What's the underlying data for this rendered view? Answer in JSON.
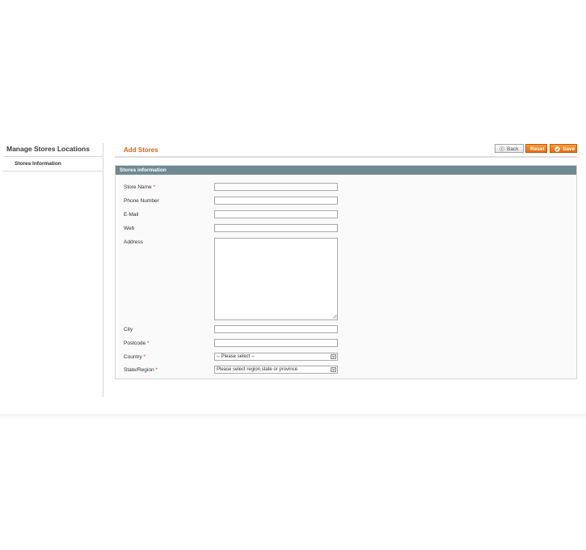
{
  "sidebar": {
    "title": "Manage Stores Locations",
    "tabs": [
      {
        "label": "Stores Information"
      }
    ]
  },
  "header": {
    "title": "Add Stores",
    "buttons": {
      "back": "Back",
      "reset": "Reset",
      "save": "Save"
    }
  },
  "fieldset": {
    "legend": "Stores information",
    "fields": {
      "store_name": {
        "label": "Store Name",
        "required": "*",
        "value": ""
      },
      "phone": {
        "label": "Phone Number",
        "value": ""
      },
      "email": {
        "label": "E-Mail",
        "value": ""
      },
      "web": {
        "label": "Web",
        "value": ""
      },
      "address": {
        "label": "Address",
        "value": ""
      },
      "city": {
        "label": "City",
        "value": ""
      },
      "postcode": {
        "label": "Postcode",
        "required": "*",
        "value": ""
      },
      "country": {
        "label": "Country",
        "required": "*",
        "selected": "-- Please select --"
      },
      "state": {
        "label": "State/Region",
        "required": "*",
        "selected": "Please select region,state or province"
      }
    }
  },
  "icons": {
    "cursor": "mouse-pointer-icon",
    "back": "back-arrow-icon",
    "save": "check-icon"
  },
  "colors": {
    "accent": "#eb5e00",
    "legend_bg": "#6f8992",
    "required": "#eb340a"
  }
}
